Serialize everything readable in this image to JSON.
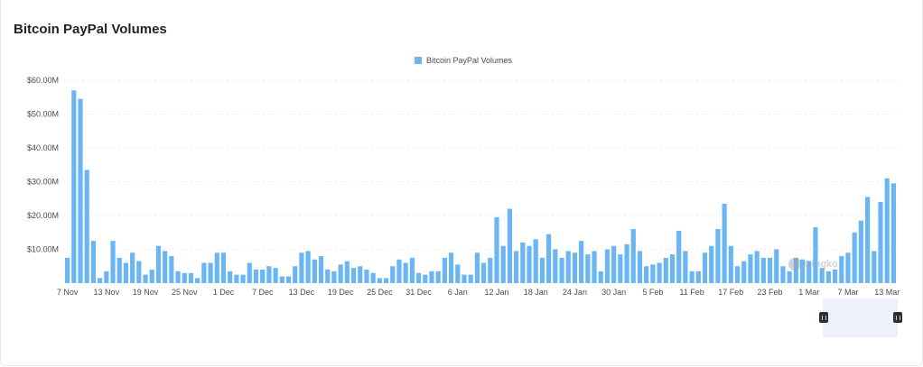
{
  "page": {
    "title": "Bitcoin PayPal Volumes"
  },
  "legend": {
    "label": "Bitcoin PayPal Volumes"
  },
  "watermark": {
    "text": "Gingko"
  },
  "colors": {
    "bar": "#6ab6f5",
    "grid": "#e9ebef",
    "navigator": "#eef1fc",
    "handle": "#2b2f36"
  },
  "chart_data": {
    "type": "bar",
    "title": "Bitcoin PayPal Volumes",
    "xlabel": "",
    "ylabel": "",
    "ylim": [
      0,
      60
    ],
    "y_unit": "M",
    "y_ticks": [
      "$10.00M",
      "$20.00M",
      "$30.00M",
      "$40.00M",
      "$50.00M",
      "$60.00M"
    ],
    "y_tick_values": [
      10,
      20,
      30,
      40,
      50,
      60
    ],
    "x_ticks": [
      "7 Nov",
      "13 Nov",
      "19 Nov",
      "25 Nov",
      "1 Dec",
      "7 Dec",
      "13 Dec",
      "19 Dec",
      "25 Dec",
      "31 Dec",
      "6 Jan",
      "12 Jan",
      "18 Jan",
      "24 Jan",
      "30 Jan",
      "5 Feb",
      "11 Feb",
      "17 Feb",
      "23 Feb",
      "1 Mar",
      "7 Mar",
      "13 Mar"
    ],
    "x_tick_index": [
      0,
      6,
      12,
      18,
      24,
      30,
      36,
      42,
      48,
      54,
      60,
      66,
      72,
      78,
      84,
      90,
      96,
      102,
      108,
      114,
      120,
      126
    ],
    "grid": true,
    "legend_position": "top-center",
    "series": [
      {
        "name": "Bitcoin PayPal Volumes",
        "values": [
          7.5,
          57,
          54.5,
          33.5,
          12.5,
          1.5,
          3.5,
          12.5,
          7.5,
          6,
          9,
          6.5,
          2.5,
          4,
          11,
          9.5,
          8,
          3.5,
          3,
          3,
          1.5,
          6,
          6,
          9,
          9,
          3.5,
          2.5,
          2.5,
          6,
          4,
          4,
          5,
          4.5,
          2,
          2,
          5,
          9,
          9.5,
          7,
          8,
          4,
          3.5,
          5.5,
          6.5,
          4.5,
          5,
          4,
          3,
          1.5,
          1.5,
          5,
          7,
          6,
          7.5,
          3,
          2.5,
          3.5,
          3.5,
          7.5,
          9,
          5.5,
          2.5,
          2.5,
          9,
          6,
          7.5,
          19.5,
          11,
          22,
          9.5,
          12,
          11,
          13,
          7.5,
          14.5,
          10,
          7.5,
          9.5,
          9,
          12.5,
          8.5,
          9.5,
          3.5,
          10,
          11,
          8.5,
          11.5,
          16,
          9.5,
          5,
          5.5,
          6,
          7.5,
          8.5,
          15.5,
          9.5,
          3.5,
          3.5,
          9,
          11,
          16,
          23.5,
          11,
          5,
          6.5,
          8.5,
          9.5,
          7.5,
          7.5,
          10,
          5,
          3.5,
          7.5,
          7,
          6.5,
          16.5,
          4.5,
          3.5,
          4,
          8,
          9,
          15,
          18.5,
          25.5,
          9.5,
          24,
          31,
          29.5
        ]
      }
    ]
  }
}
